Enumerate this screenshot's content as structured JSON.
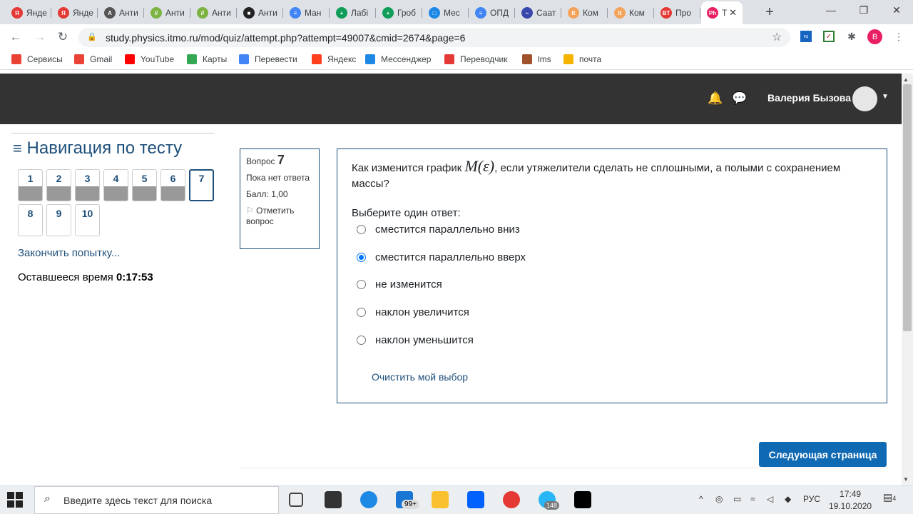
{
  "browser": {
    "tabs": [
      {
        "label": "Янде",
        "color": "#e53935",
        "glyph": "Я"
      },
      {
        "label": "Янде",
        "color": "#e53935",
        "glyph": "Я"
      },
      {
        "label": "Анти",
        "color": "#555555",
        "glyph": "А"
      },
      {
        "label": "Анти",
        "color": "#7cb342",
        "glyph": "//"
      },
      {
        "label": "Анти",
        "color": "#7cb342",
        "glyph": "//"
      },
      {
        "label": "Анти",
        "color": "#222222",
        "glyph": "■"
      },
      {
        "label": "Ман",
        "color": "#4285f4",
        "glyph": "≡"
      },
      {
        "label": "Лабі",
        "color": "#0f9d58",
        "glyph": "+"
      },
      {
        "label": "Гроб",
        "color": "#0f9d58",
        "glyph": "+"
      },
      {
        "label": "Мес",
        "color": "#1e88e5",
        "glyph": "□"
      },
      {
        "label": "ОПД",
        "color": "#4285f4",
        "glyph": "≡"
      },
      {
        "label": "Саат",
        "color": "#3949ab",
        "glyph": "~"
      },
      {
        "label": "Ком",
        "color": "#f5a45d",
        "glyph": "lt"
      },
      {
        "label": "Ком",
        "color": "#f5a45d",
        "glyph": "lt"
      },
      {
        "label": "Про",
        "color": "#e53935",
        "glyph": "BT"
      },
      {
        "label": "Т",
        "color": "#e91e63",
        "glyph": "Ph"
      }
    ],
    "url": "study.physics.itmo.ru/mod/quiz/attempt.php?attempt=49007&cmid=2674&page=6",
    "profile_letter": "B",
    "bookmarks": [
      {
        "label": "Сервисы",
        "color": "#ea4335"
      },
      {
        "label": "Gmail",
        "color": "#ea4335"
      },
      {
        "label": "YouTube",
        "color": "#ff0000"
      },
      {
        "label": "Карты",
        "color": "#34a853"
      },
      {
        "label": "Перевести",
        "color": "#4285f4"
      },
      {
        "label": "Яндекс",
        "color": "#fc3f1d"
      },
      {
        "label": "Мессенджер",
        "color": "#1e88e5"
      },
      {
        "label": "Переводчик",
        "color": "#e53935"
      },
      {
        "label": "lms",
        "color": "#a0522d"
      },
      {
        "label": "почта",
        "color": "#f4b400"
      }
    ]
  },
  "header": {
    "user_name": "Валерия Бызова"
  },
  "quiz_nav": {
    "title": "Навигация по тесту",
    "questions": [
      "1",
      "2",
      "3",
      "4",
      "5",
      "6",
      "7",
      "8",
      "9",
      "10"
    ],
    "finish_link": "Закончить попытку...",
    "time_label": "Оставшееся время",
    "time_value": "0:17:53"
  },
  "question": {
    "label": "Вопрос",
    "number": "7",
    "state": "Пока нет ответа",
    "grade": "Балл: 1,00",
    "flag": "Отметить вопрос",
    "text_before": "Как изменится график ",
    "math": "M(ε)",
    "text_after": ", если утяжелители сделать не сплошными, а полыми с сохранением массы?",
    "prompt": "Выберите один ответ:",
    "options": [
      "сместится параллельно вниз",
      "сместится параллельно вверх",
      "не изменится",
      "наклон увеличится",
      "наклон уменьшится"
    ],
    "selected_option": "сместится параллельно вверх",
    "clear_label": "Очистить мой выбор",
    "next_button": "Следующая страница"
  },
  "taskbar": {
    "search_placeholder": "Введите здесь текст для поиска",
    "mail_badge": "99+",
    "telegram_badge": "148",
    "language": "РУС",
    "time": "17:49",
    "date": "19.10.2020",
    "notifications": "4"
  }
}
